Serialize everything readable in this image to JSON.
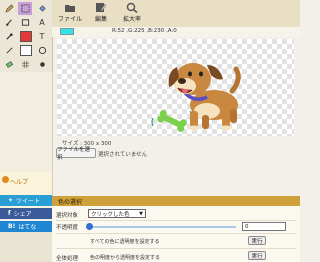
{
  "toolbar": {
    "buttons": [
      {
        "label": "ファイル",
        "icon": "folder-icon"
      },
      {
        "label": "編集",
        "icon": "edit-icon"
      },
      {
        "label": "拡大率",
        "icon": "zoom-icon"
      }
    ]
  },
  "info": {
    "color_hex": "#34e1e6",
    "readout": "R:52 ,G:225 ,B:230 ,A:0"
  },
  "canvas": {
    "size_label": "サイズ : 300 x 300",
    "file_button": "ファイルを選択",
    "file_status": "選択されていません"
  },
  "sidebar": {
    "help": "ヘルプ",
    "tweet": "ツイート",
    "share": "シェア",
    "hatena": "はてな"
  },
  "tools": {
    "tool_icons": [
      "pencil-icon",
      "square-icon",
      "fill-icon",
      "text-icon",
      "brush-icon",
      "rect-icon",
      "dropper-icon",
      "type-icon",
      "line-icon",
      "eraser-icon",
      "circle-icon",
      "dot-icon"
    ],
    "swatch_color_1": "#e23a3a",
    "swatch_color_2": "#ffffff"
  },
  "panel": {
    "title": "色の選択",
    "target_label": "選択対象",
    "target_value": "クリックした色",
    "opacity_label": "不透明度",
    "opacity_value": "0",
    "all_label": "全体処理",
    "desc1": "すべての色に透明度を設定する",
    "desc2": "色の明度から透明度を設定する",
    "exec": "実行"
  }
}
